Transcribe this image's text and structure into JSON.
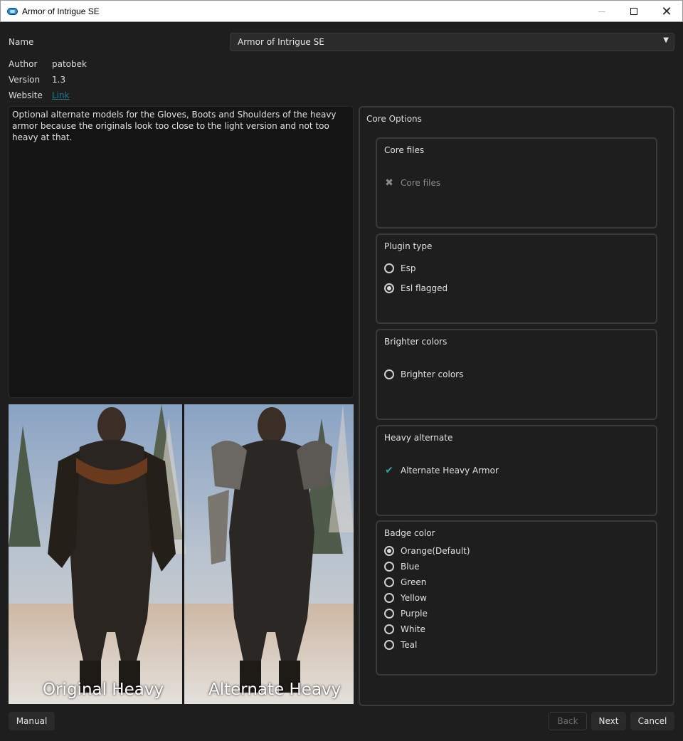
{
  "window": {
    "title": "Armor of Intrigue SE"
  },
  "header": {
    "name_label": "Name",
    "name_value": "Armor of Intrigue SE",
    "author_label": "Author",
    "author_value": "patobek",
    "version_label": "Version",
    "version_value": "1.3",
    "website_label": "Website",
    "website_link": "Link"
  },
  "description": "Optional alternate models for the Gloves, Boots and Shoulders of the heavy armor because the originals look too close to the light version and not too heavy at that.",
  "preview": {
    "caption_left": "Original Heavy",
    "caption_right": "Alternate Heavy"
  },
  "options": {
    "title": "Core Options",
    "groups": [
      {
        "title": "Core files",
        "items": [
          {
            "label": "Core files",
            "kind": "required",
            "selected": true
          }
        ]
      },
      {
        "title": "Plugin type",
        "items": [
          {
            "label": "Esp",
            "kind": "radio",
            "selected": false
          },
          {
            "label": "Esl flagged",
            "kind": "radio",
            "selected": true
          }
        ]
      },
      {
        "title": "Brighter colors",
        "items": [
          {
            "label": "Brighter colors",
            "kind": "radio",
            "selected": false
          }
        ]
      },
      {
        "title": "Heavy alternate",
        "items": [
          {
            "label": "Alternate Heavy Armor",
            "kind": "checked",
            "selected": true
          }
        ]
      },
      {
        "title": "Badge color",
        "items": [
          {
            "label": "Orange(Default)",
            "kind": "radio",
            "selected": true
          },
          {
            "label": "Blue",
            "kind": "radio",
            "selected": false
          },
          {
            "label": "Green",
            "kind": "radio",
            "selected": false
          },
          {
            "label": "Yellow",
            "kind": "radio",
            "selected": false
          },
          {
            "label": "Purple",
            "kind": "radio",
            "selected": false
          },
          {
            "label": "White",
            "kind": "radio",
            "selected": false
          },
          {
            "label": "Teal",
            "kind": "radio",
            "selected": false
          }
        ]
      }
    ]
  },
  "buttons": {
    "manual": "Manual",
    "back": "Back",
    "next": "Next",
    "cancel": "Cancel"
  },
  "colors": {
    "accent_check": "#2aa6a0",
    "link": "#1e7a8c",
    "background": "#1e1e1e"
  }
}
